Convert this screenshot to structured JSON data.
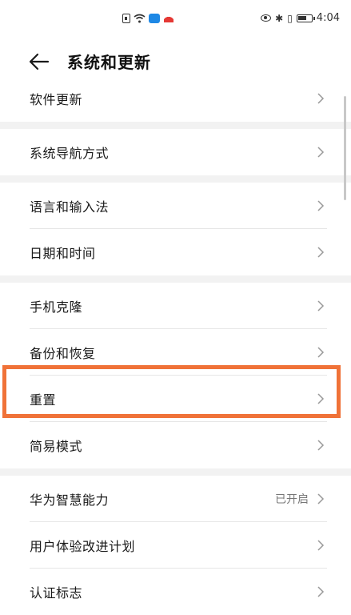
{
  "status_bar": {
    "time": "4:04",
    "left_icons": [
      "sim-card-icon",
      "wifi-icon",
      "cloud-icon",
      "huawei-icon"
    ],
    "right_icons": [
      "eye-icon",
      "bluetooth-icon",
      "vibrate-icon",
      "battery-icon"
    ]
  },
  "header": {
    "title": "系统和更新",
    "back_icon": "back-arrow-icon"
  },
  "items": [
    {
      "label": "软件更新"
    },
    {
      "label": "系统导航方式"
    },
    {
      "label": "语言和输入法"
    },
    {
      "label": "日期和时间"
    },
    {
      "label": "手机克隆"
    },
    {
      "label": "备份和恢复"
    },
    {
      "label": "重置"
    },
    {
      "label": "简易模式"
    },
    {
      "label": "华为智慧能力",
      "value": "已开启"
    },
    {
      "label": "用户体验改进计划"
    },
    {
      "label": "认证标志"
    }
  ],
  "highlight_color": "#f07238"
}
